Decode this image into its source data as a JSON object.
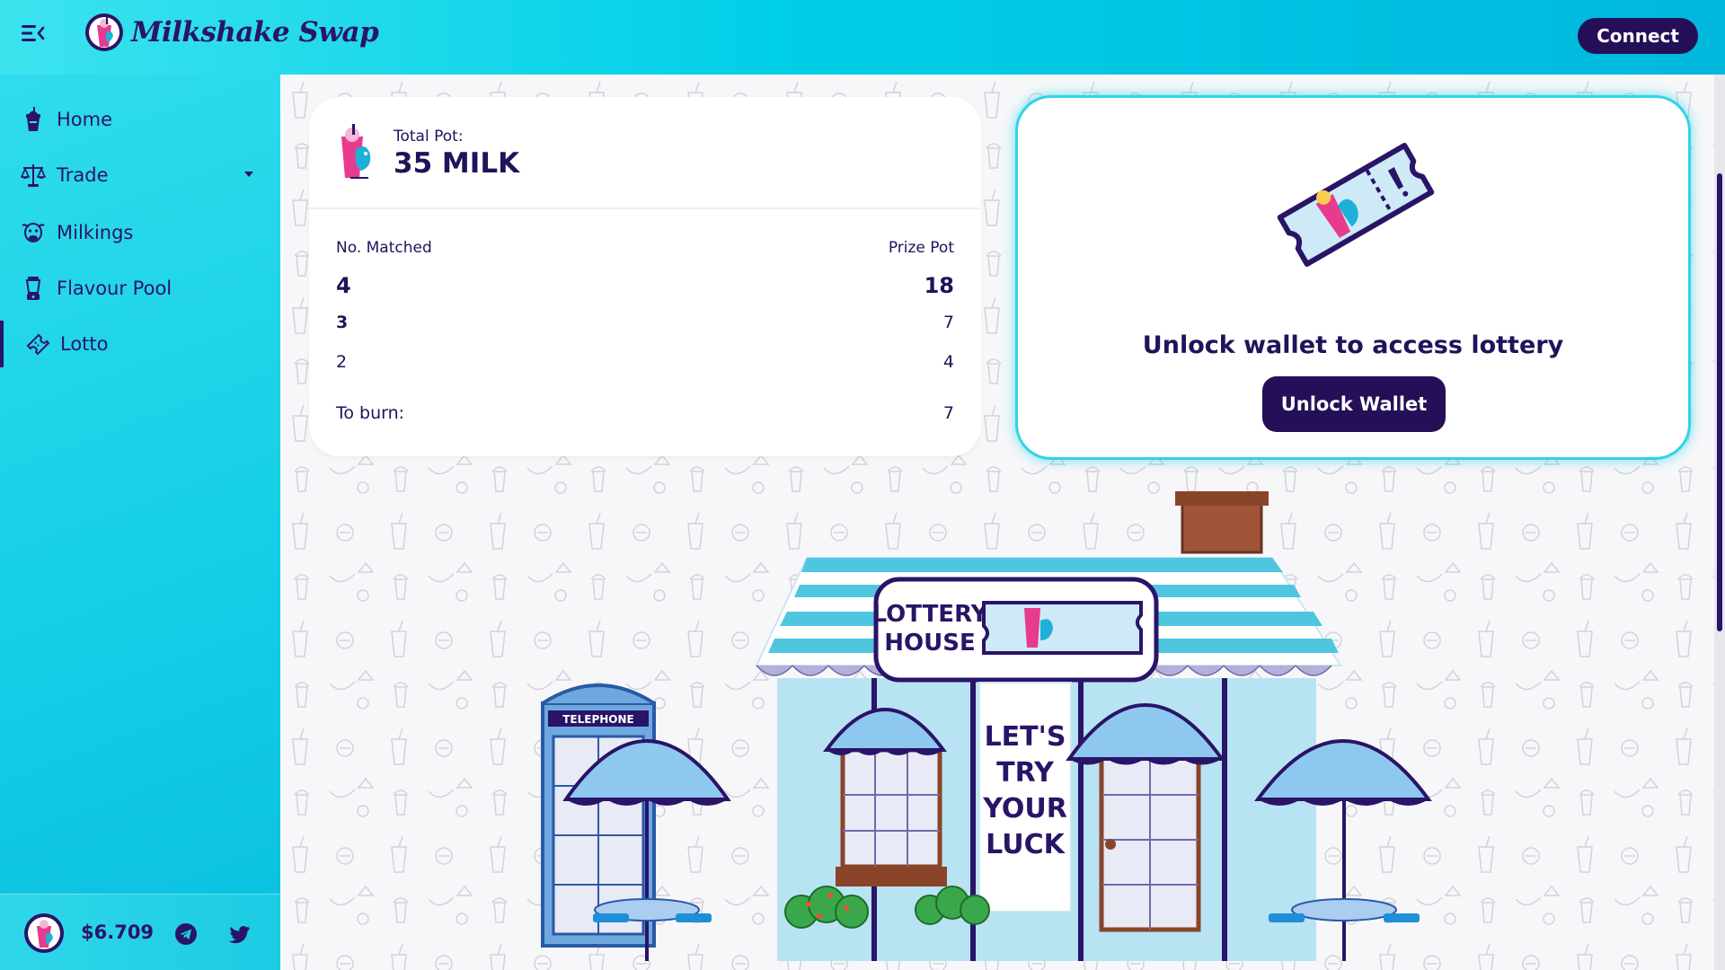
{
  "header": {
    "brand": "Milkshake Swap",
    "connect_label": "Connect"
  },
  "sidebar": {
    "items": [
      {
        "label": "Home",
        "icon": "milkshake-icon"
      },
      {
        "label": "Trade",
        "icon": "scale-icon"
      },
      {
        "label": "Milkings",
        "icon": "cow-icon"
      },
      {
        "label": "Flavour Pool",
        "icon": "blender-icon"
      },
      {
        "label": "Lotto",
        "icon": "ticket-icon",
        "active": true
      }
    ],
    "price": "$6.709"
  },
  "pot": {
    "label": "Total Pot:",
    "value": "35 MILK",
    "col_matched": "No. Matched",
    "col_prize": "Prize Pot",
    "rows": [
      {
        "matched": "4",
        "prize": "18"
      },
      {
        "matched": "3",
        "prize": "7"
      },
      {
        "matched": "2",
        "prize": "4"
      }
    ],
    "burn_label": "To burn:",
    "burn_value": "7"
  },
  "lottery": {
    "message": "Unlock wallet to access lottery",
    "button_label": "Unlock Wallet"
  },
  "scene": {
    "sign_line1": "LOTTERY",
    "sign_line2": "HOUSE",
    "banner_line1": "LET'S",
    "banner_line2": "TRY",
    "banner_line3": "YOUR",
    "banner_line4": "LUCK",
    "booth_label": "TELEPHONE"
  },
  "colors": {
    "brand_dark": "#250f58",
    "accent_cyan": "#00cfe8",
    "text_primary": "#22125a"
  }
}
